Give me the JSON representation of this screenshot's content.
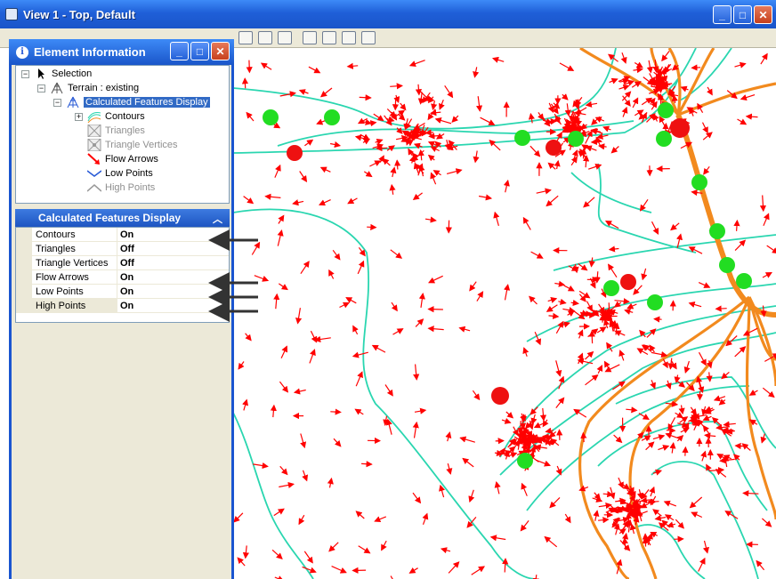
{
  "window": {
    "title": "View 1 - Top, Default"
  },
  "panel": {
    "title": "Element Information",
    "tree": [
      {
        "label": "Selection",
        "icon": "pointer-icon",
        "state": "normal"
      },
      {
        "label": "Terrain : existing",
        "icon": "terrain-icon",
        "state": "normal"
      },
      {
        "label": "Calculated Features Display",
        "icon": "calculated-features-icon",
        "state": "selected"
      },
      {
        "label": "Contours",
        "icon": "contours-icon",
        "state": "normal"
      },
      {
        "label": "Triangles",
        "icon": "triangles-icon",
        "state": "disabled"
      },
      {
        "label": "Triangle Vertices",
        "icon": "triangle-vertices-icon",
        "state": "disabled"
      },
      {
        "label": "Flow Arrows",
        "icon": "flow-arrows-icon",
        "state": "normal"
      },
      {
        "label": "Low Points",
        "icon": "low-points-icon",
        "state": "normal"
      },
      {
        "label": "High Points",
        "icon": "high-points-icon",
        "state": "disabled"
      }
    ],
    "section_title": "Calculated Features Display",
    "properties": [
      {
        "name": "Contours",
        "value": "On"
      },
      {
        "name": "Triangles",
        "value": "Off"
      },
      {
        "name": "Triangle Vertices",
        "value": "Off"
      },
      {
        "name": "Flow Arrows",
        "value": "On"
      },
      {
        "name": "Low Points",
        "value": "On"
      },
      {
        "name": "High Points",
        "value": "On"
      }
    ]
  },
  "colors": {
    "flow_arrow": "#ff0000",
    "contour": "#2ad6b0",
    "ridge": "#f28a1e",
    "low_point": "#22dd22",
    "high_point": "#ee1111",
    "title_bar": "#1f5fd8"
  }
}
